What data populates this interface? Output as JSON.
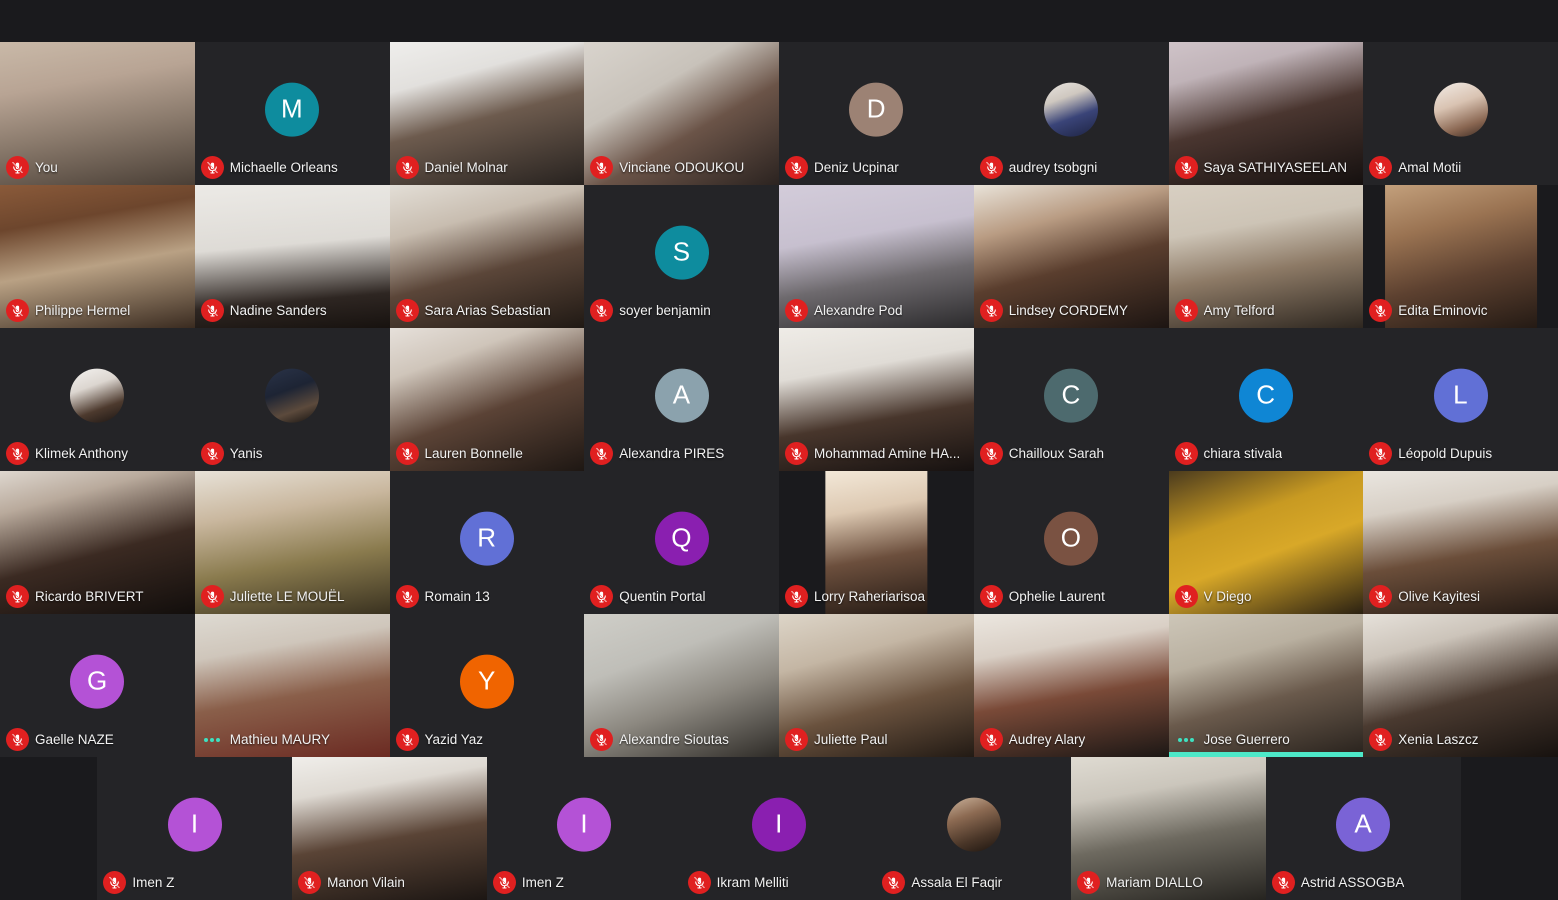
{
  "app": {
    "name": "Zoom Meeting Gallery View",
    "background_color": "#1a1a1d",
    "tile_background_color": "#242427",
    "mute_icon_color": "#e02020",
    "speaking_indicator_color": "#3ee0c0",
    "active_speaker_highlight_color": "#4de8c8",
    "name_text_color": "#f2f2f2"
  },
  "grid": {
    "columns": 8,
    "rows": 7,
    "total_participants": 55
  },
  "rows": [
    {
      "index": 0,
      "tiles": [
        {
          "name": "You",
          "kind": "video",
          "muted": true,
          "speaking": false,
          "video_style": "linear-gradient(170deg,#c9b9a8 0%,#b8a494 30%,#8a7a6c 60%,#4a3f36 100%)",
          "video_fit": "full"
        },
        {
          "name": "Michaelle Orleans",
          "kind": "avatar",
          "initial": "M",
          "avatar_color": "#0e8c9e",
          "muted": true,
          "speaking": false
        },
        {
          "name": "Daniel Molnar",
          "kind": "video",
          "muted": true,
          "speaking": false,
          "video_style": "linear-gradient(165deg,#efeeec 0%,#e2e0dd 26%,#6d5b4e 52%,#27221f 100%)",
          "video_fit": "full"
        },
        {
          "name": "Vinciane ODOUKOU",
          "kind": "video",
          "muted": true,
          "speaking": false,
          "video_style": "linear-gradient(150deg,#d9d4cd 0%,#c8c2ba 34%,#6b5448 60%,#2b2320 100%)",
          "video_fit": "full"
        },
        {
          "name": "Deniz Ucpinar",
          "kind": "avatar",
          "initial": "D",
          "avatar_color": "#9c8274",
          "muted": true,
          "speaking": false
        },
        {
          "name": "audrey tsobgni",
          "kind": "avatar-photo",
          "avatar_color": "#3b4a7a",
          "avatar_style": "linear-gradient(160deg,#e8e4df 0%,#cfc8c0 30%,#3a4478 62%,#1d2342 100%)",
          "muted": true,
          "speaking": false
        },
        {
          "name": "Saya SATHIYASEELAN",
          "kind": "video",
          "muted": true,
          "speaking": false,
          "video_style": "linear-gradient(165deg,#cfc3c8 0%,#c0b3b8 22%,#4a3630 52%,#15100f 100%)",
          "video_fit": "full"
        },
        {
          "name": "Amal Motii",
          "kind": "avatar-photo",
          "avatar_color": "#cbb2a0",
          "avatar_style": "linear-gradient(160deg,#f2ece6 0%,#d9c3b2 40%,#8a6752 75%,#3a2a22 100%)",
          "muted": true,
          "speaking": false
        }
      ]
    },
    {
      "index": 1,
      "tiles": [
        {
          "name": "Philippe Hermel",
          "kind": "video",
          "muted": true,
          "speaking": false,
          "video_style": "linear-gradient(170deg,#8a5a3a 0%,#6d462d 26%,#b9a184 55%,#3a2b20 100%)",
          "video_fit": "full"
        },
        {
          "name": "Nadine Sanders",
          "kind": "video",
          "muted": true,
          "speaking": false,
          "video_style": "linear-gradient(175deg,#eceae6 0%,#dedbd6 42%,#2e2622 78%,#17120f 100%)",
          "video_fit": "full"
        },
        {
          "name": "Sara Arias Sebastian",
          "kind": "video",
          "muted": true,
          "speaking": false,
          "video_style": "linear-gradient(165deg,#e3ded6 0%,#c8bdb0 28%,#5b4639 58%,#201914 100%)",
          "video_fit": "full"
        },
        {
          "name": "soyer benjamin",
          "kind": "avatar",
          "initial": "S",
          "avatar_color": "#0e8c9e",
          "muted": true,
          "speaking": false
        },
        {
          "name": "Alexandre Pod",
          "kind": "video",
          "muted": true,
          "speaking": false,
          "video_style": "linear-gradient(170deg,#d3ccda 0%,#c7c0cf 36%,#6e6a6e 64%,#2b2a2c 100%)",
          "video_fit": "full"
        },
        {
          "name": "Lindsey CORDEMY",
          "kind": "video",
          "muted": true,
          "speaking": false,
          "video_style": "linear-gradient(165deg,#e9e3d9 0%,#b99c83 28%,#5a3e2e 56%,#1d1512 100%)",
          "video_fit": "full"
        },
        {
          "name": "Amy Telford",
          "kind": "video",
          "muted": true,
          "speaking": false,
          "video_style": "linear-gradient(170deg,#d8cfc2 0%,#cdc4b6 30%,#8d7a66 58%,#2e2720 100%)",
          "video_fit": "full"
        },
        {
          "name": "Edita Eminovic",
          "kind": "video",
          "muted": true,
          "speaking": false,
          "video_style": "linear-gradient(165deg,#c3a07c 0%,#9a7352 30%,#5d4130 62%,#241a14 100%)",
          "video_fit": "narrow2"
        }
      ]
    },
    {
      "index": 2,
      "tiles": [
        {
          "name": "Klimek Anthony",
          "kind": "avatar-photo",
          "avatar_color": "#e8e8e8",
          "avatar_style": "linear-gradient(160deg,#f4f2f0 0%,#dcd6d0 34%,#4d3a2e 70%,#1a1412 100%)",
          "muted": true,
          "speaking": false
        },
        {
          "name": "Yanis",
          "kind": "avatar-photo",
          "avatar_color": "#232a3a",
          "avatar_style": "linear-gradient(160deg,#2a3348 0%,#1d2434 40%,#5c4a3c 72%,#14110f 100%)",
          "muted": true,
          "speaking": false
        },
        {
          "name": "Lauren Bonnelle",
          "kind": "video",
          "muted": true,
          "speaking": false,
          "video_style": "linear-gradient(160deg,#e6e0da 0%,#cfc5ba 24%,#5b4336 56%,#1e1713 100%)",
          "video_fit": "full"
        },
        {
          "name": "Alexandra PIRES",
          "kind": "avatar",
          "initial": "A",
          "avatar_color": "#8ba2ad",
          "muted": true,
          "speaking": false
        },
        {
          "name": "Mohammad Amine HA...",
          "kind": "video",
          "muted": true,
          "speaking": false,
          "video_style": "linear-gradient(170deg,#efece7 0%,#e0dcd6 30%,#48362c 62%,#161110 100%)",
          "video_fit": "full"
        },
        {
          "name": "Chailloux Sarah",
          "kind": "avatar",
          "initial": "C",
          "avatar_color": "#4d6a6e",
          "muted": true,
          "speaking": false
        },
        {
          "name": "chiara stivala",
          "kind": "avatar",
          "initial": "C",
          "avatar_color": "#0f86d4",
          "muted": true,
          "speaking": false
        },
        {
          "name": "Léopold Dupuis",
          "kind": "avatar",
          "initial": "L",
          "avatar_color": "#6170d6",
          "muted": true,
          "speaking": false
        }
      ]
    },
    {
      "index": 3,
      "tiles": [
        {
          "name": "Ricardo BRIVERT",
          "kind": "video",
          "muted": true,
          "speaking": false,
          "video_style": "linear-gradient(165deg,#ded7cf 0%,#b9aa9c 22%,#3b2a22 56%,#120e0c 100%)",
          "video_fit": "full"
        },
        {
          "name": "Juliette LE MOUËL",
          "kind": "video",
          "muted": true,
          "speaking": false,
          "video_style": "linear-gradient(170deg,#e8e2d8 0%,#c9b79e 30%,#8a7b4e 62%,#3a3220 100%)",
          "video_fit": "full"
        },
        {
          "name": "Romain 13",
          "kind": "avatar",
          "initial": "R",
          "avatar_color": "#6170d6",
          "muted": true,
          "speaking": false
        },
        {
          "name": "Quentin Portal",
          "kind": "avatar",
          "initial": "Q",
          "avatar_color": "#8a1fb0",
          "muted": true,
          "speaking": false
        },
        {
          "name": "Lorry Raheriarisoa",
          "kind": "video",
          "muted": true,
          "speaking": false,
          "video_style": "linear-gradient(170deg,#f3e8d8 0%,#ddc9b2 28%,#6c4f3d 60%,#241a14 100%)",
          "video_fit": "narrow"
        },
        {
          "name": "Ophelie Laurent",
          "kind": "avatar",
          "initial": "O",
          "avatar_color": "#7a5242",
          "muted": true,
          "speaking": false
        },
        {
          "name": "V Diego",
          "kind": "video",
          "muted": true,
          "speaking": false,
          "video_style": "linear-gradient(160deg,#4a3a1e 0%,#c89a22 34%,#d8a828 56%,#2b2112 100%)",
          "video_fit": "full"
        },
        {
          "name": "Olive Kayitesi",
          "kind": "video",
          "muted": true,
          "speaking": false,
          "video_style": "linear-gradient(170deg,#eae6e0 0%,#d7cfc5 26%,#6b4e3a 58%,#241a14 100%)",
          "video_fit": "full"
        }
      ]
    },
    {
      "index": 4,
      "tiles": [
        {
          "name": "Gaelle NAZE",
          "kind": "avatar",
          "initial": "G",
          "avatar_color": "#b452d6",
          "muted": true,
          "speaking": false
        },
        {
          "name": "Mathieu MAURY",
          "kind": "video",
          "muted": false,
          "speaking": true,
          "video_style": "linear-gradient(170deg,#dedad2 0%,#cfc6bb 26%,#8a5f4a 56%,#6b2a22 100%)",
          "video_fit": "full"
        },
        {
          "name": "Yazid Yaz",
          "kind": "avatar",
          "initial": "Y",
          "avatar_color": "#f06400",
          "muted": true,
          "speaking": false
        },
        {
          "name": "Alexandre Sioutas",
          "kind": "video",
          "muted": true,
          "speaking": false,
          "video_style": "linear-gradient(160deg,#cfcec8 0%,#bfbeb8 32%,#8c8880 60%,#2e2b27 100%)",
          "video_fit": "full"
        },
        {
          "name": "Juliette Paul",
          "kind": "video",
          "muted": true,
          "speaking": false,
          "video_style": "linear-gradient(165deg,#ddd5c8 0%,#c4b6a4 30%,#6a523e 62%,#221a14 100%)",
          "video_fit": "full"
        },
        {
          "name": "Audrey Alary",
          "kind": "video",
          "muted": true,
          "speaking": false,
          "video_style": "linear-gradient(170deg,#ece7e0 0%,#d9cfc5 26%,#7a4a38 56%,#1c1715 100%)",
          "video_fit": "full"
        },
        {
          "name": "Jose Guerrero",
          "kind": "video",
          "muted": false,
          "speaking": true,
          "active_speaker": true,
          "video_style": "linear-gradient(165deg,#cdc6b8 0%,#b9b0a0 30%,#6a5a4c 58%,#27211c 100%)",
          "video_fit": "full"
        },
        {
          "name": "Xenia Laszcz",
          "kind": "video",
          "muted": true,
          "speaking": false,
          "video_style": "linear-gradient(165deg,#e6e1da 0%,#ccc4ba 24%,#4a3a30 58%,#17120f 100%)",
          "video_fit": "full"
        }
      ]
    },
    {
      "index": 5,
      "tiles": [
        {
          "name": "Imen Z",
          "kind": "avatar",
          "initial": "I",
          "avatar_color": "#b452d6",
          "muted": true,
          "speaking": false
        },
        {
          "name": "Manon Vilain",
          "kind": "video",
          "muted": true,
          "speaking": false,
          "video_style": "linear-gradient(170deg,#f0eeea 0%,#ded9d2 24%,#5a4436 56%,#1c1613 100%)",
          "video_fit": "full"
        },
        {
          "name": "Imen Z",
          "kind": "avatar",
          "initial": "I",
          "avatar_color": "#b452d6",
          "muted": true,
          "speaking": false
        },
        {
          "name": "Ikram Melliti",
          "kind": "avatar",
          "initial": "I",
          "avatar_color": "#8a1fb0",
          "muted": true,
          "speaking": false
        },
        {
          "name": "Assala El Faqir",
          "kind": "avatar-photo",
          "avatar_color": "#6e5242",
          "avatar_style": "linear-gradient(160deg,#cbb39c 0%,#8c6a52 34%,#4a3628 70%,#1c140f 100%)",
          "muted": true,
          "speaking": false
        },
        {
          "name": "Mariam DIALLO",
          "kind": "video",
          "muted": true,
          "speaking": false,
          "video_style": "linear-gradient(170deg,#dfdbd2 0%,#cbc6bc 26%,#6e6a60 56%,#262420 100%)",
          "video_fit": "full"
        },
        {
          "name": "Astrid ASSOGBA",
          "kind": "avatar",
          "initial": "A",
          "avatar_color": "#7a63d6",
          "muted": true,
          "speaking": false
        }
      ]
    }
  ]
}
